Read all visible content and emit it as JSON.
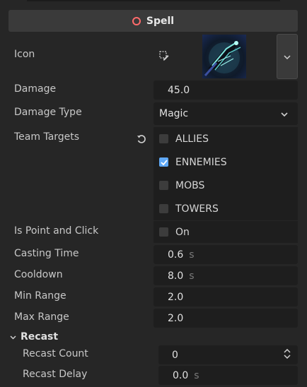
{
  "header": {
    "title": "Spell",
    "accent": "#ff6b6b"
  },
  "rows": {
    "icon": {
      "label": "Icon",
      "edit_icon": "edit-resource-icon",
      "dropdown_icon": "chevron-down-icon"
    },
    "damage": {
      "label": "Damage",
      "value": "45.0"
    },
    "damage_type": {
      "label": "Damage Type",
      "value": "Magic"
    },
    "team_targets": {
      "label": "Team Targets",
      "reset_icon": "revert-icon",
      "options": [
        {
          "label": "ALLIES",
          "checked": false
        },
        {
          "label": "ENNEMIES",
          "checked": true
        },
        {
          "label": "MOBS",
          "checked": false
        },
        {
          "label": "TOWERS",
          "checked": false
        }
      ]
    },
    "point_click": {
      "label": "Is Point and Click",
      "value": "On",
      "checked": false
    },
    "casting_time": {
      "label": "Casting Time",
      "value": "0.6",
      "unit": "s"
    },
    "cooldown": {
      "label": "Cooldown",
      "value": "8.0",
      "unit": "s"
    },
    "min_range": {
      "label": "Min Range",
      "value": "2.0"
    },
    "max_range": {
      "label": "Max Range",
      "value": "2.0"
    }
  },
  "recast": {
    "title": "Recast",
    "count": {
      "label": "Recast Count",
      "value": "0"
    },
    "delay": {
      "label": "Recast Delay",
      "value": "0.0",
      "unit": "s"
    }
  },
  "colors": {
    "background": "#262626",
    "field": "#1e1e1e",
    "check": "#5fa8f5"
  }
}
